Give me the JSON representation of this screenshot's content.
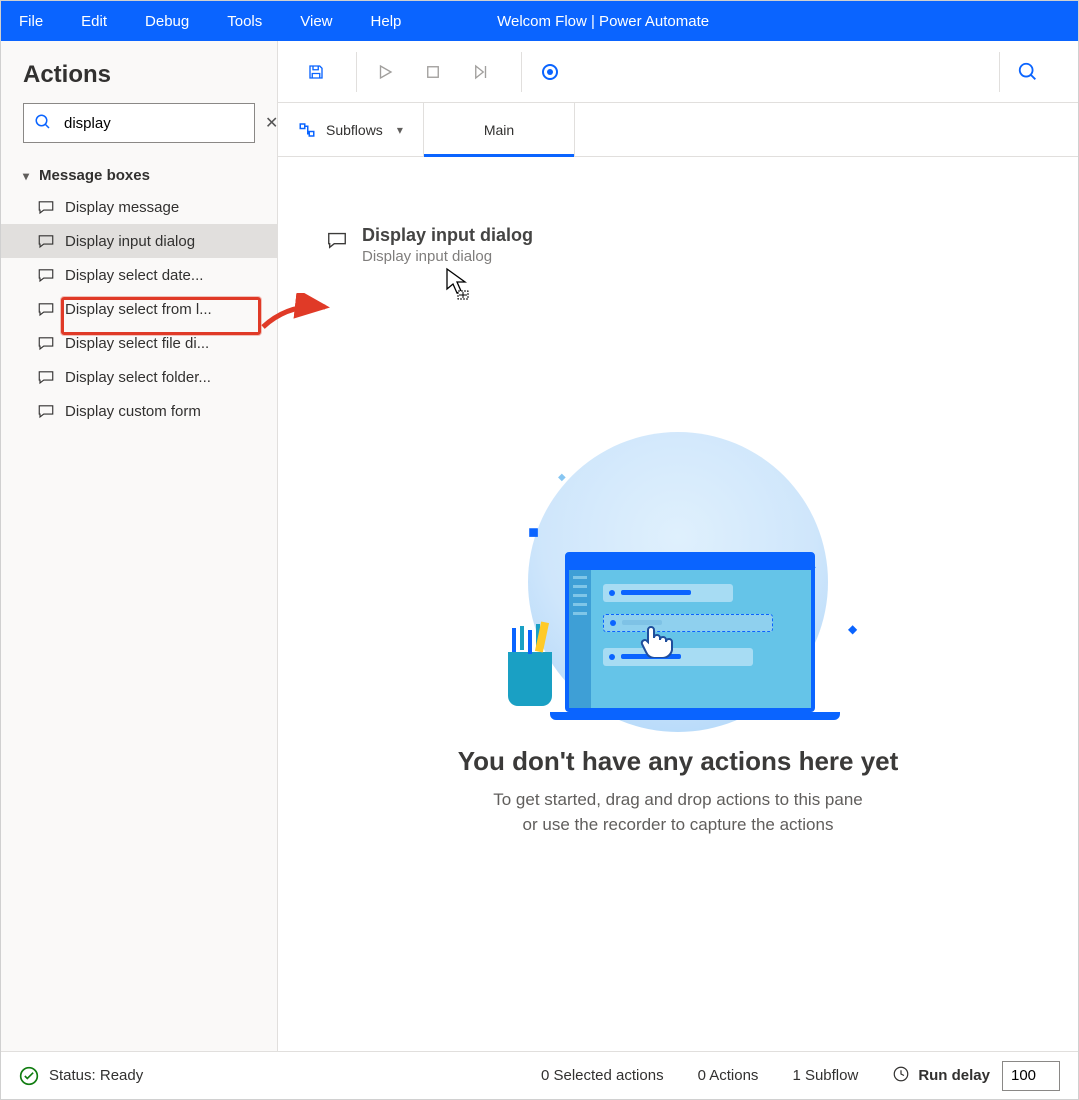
{
  "menubar": {
    "items": [
      "File",
      "Edit",
      "Debug",
      "Tools",
      "View",
      "Help"
    ],
    "title": "Welcom Flow | Power Automate"
  },
  "sidebar": {
    "heading": "Actions",
    "search_value": "display",
    "group": {
      "name": "Message boxes",
      "items": [
        "Display message",
        "Display input dialog",
        "Display select date...",
        "Display select from l...",
        "Display select file di...",
        "Display select folder...",
        "Display custom form"
      ],
      "selected_index": 1
    }
  },
  "tabs": {
    "subflows_label": "Subflows",
    "main_label": "Main"
  },
  "drag": {
    "title": "Display input dialog",
    "subtitle": "Display input dialog"
  },
  "empty": {
    "heading": "You don't have any actions here yet",
    "line1": "To get started, drag and drop actions to this pane",
    "line2": "or use the recorder to capture the actions"
  },
  "status": {
    "text": "Status: Ready",
    "selected": "0 Selected actions",
    "actions": "0 Actions",
    "subflows": "1 Subflow",
    "run_delay_label": "Run delay",
    "run_delay_value": "100"
  }
}
